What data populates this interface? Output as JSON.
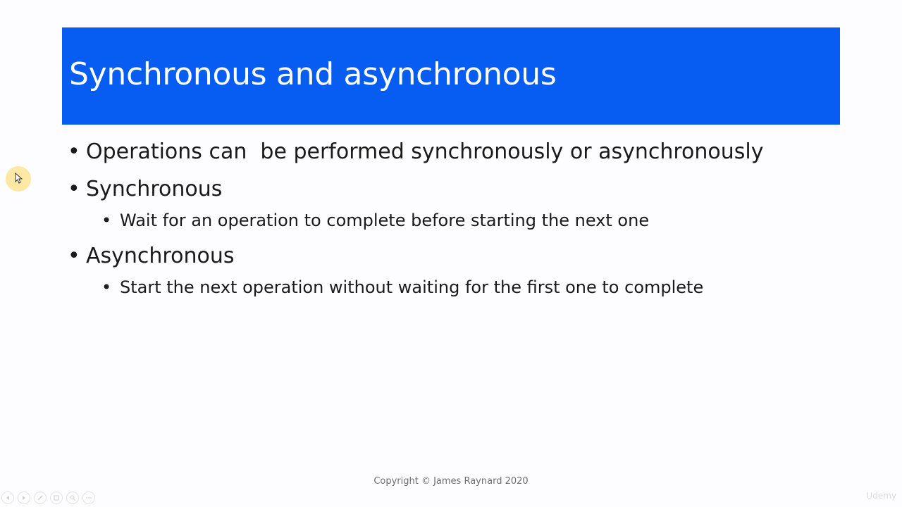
{
  "slide": {
    "title": "Synchronous and asynchronous",
    "bullets": [
      {
        "text": "Operations can  be performed synchronously or asynchronously"
      },
      {
        "text": "Synchronous"
      },
      {
        "text": "Wait for an operation to complete before starting the next one"
      },
      {
        "text": "Asynchronous"
      },
      {
        "text": "Start the next operation without waiting for the first one to complete"
      }
    ],
    "bullet_glyph": "•",
    "footer": "Copyright © James Raynard 2020"
  },
  "overlay": {
    "watermark": "Udemy",
    "controls": [
      "previous-icon",
      "next-icon",
      "pen-icon",
      "slides-icon",
      "zoom-icon",
      "more-icon"
    ]
  },
  "colors": {
    "title_band": "#075cf2",
    "title_text": "#ffffff",
    "body_text": "#1a1a1a",
    "background": "#fdfcfe",
    "cursor_highlight": "#fce38c"
  }
}
